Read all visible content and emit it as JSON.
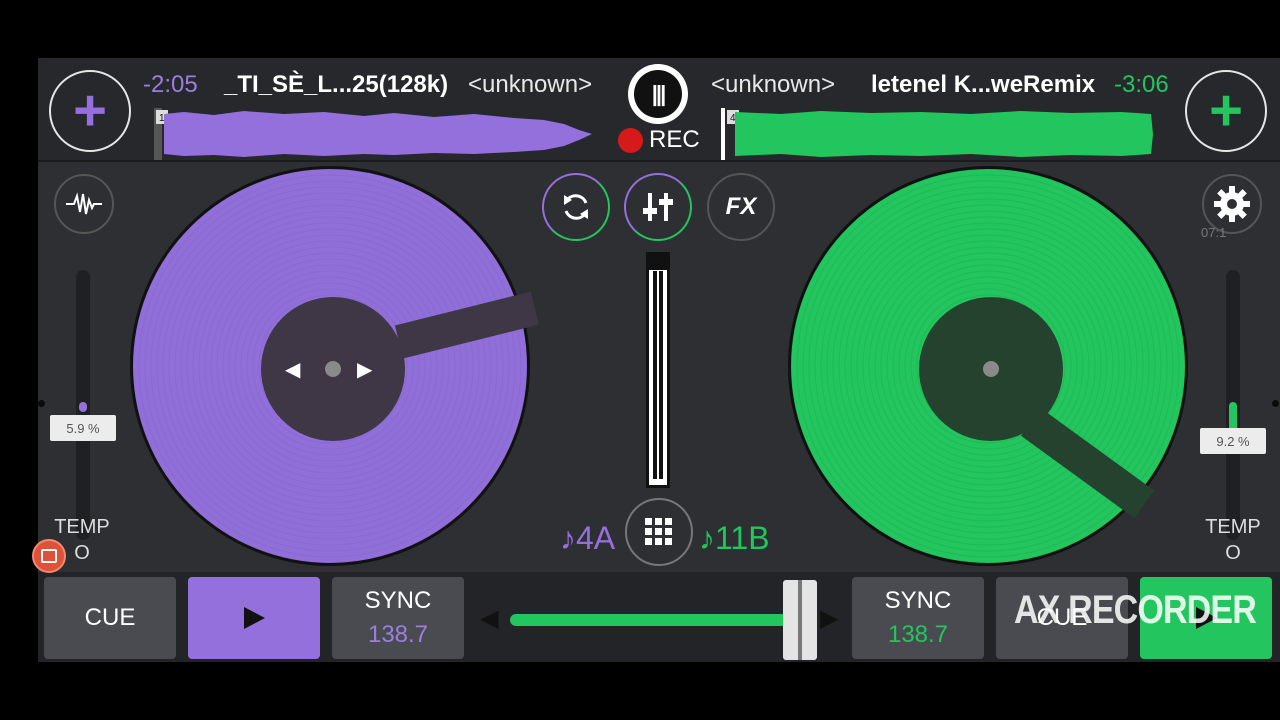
{
  "deck_left": {
    "time_remaining": "-2:05",
    "title": "_TI_SÈ_L...25(128k)",
    "artist": "<unknown>",
    "cue_marker": "1",
    "key": "♪4A",
    "tempo_value": "5.9 %",
    "tempo_label": "TEMP",
    "tempo_sub": "O",
    "cue_label": "CUE",
    "sync_label": "SYNC",
    "bpm": "138.7",
    "accent_color": "#9370db"
  },
  "deck_right": {
    "time_remaining": "-3:06",
    "title": "letenel K...weRemix",
    "artist": "<unknown>",
    "cue_marker": "4",
    "key": "♪11B",
    "tempo_value": "9.2 %",
    "tempo_label": "TEMP",
    "tempo_sub": "O",
    "cue_label": "CUE",
    "sync_label": "SYNC",
    "bpm": "138.7",
    "accent_color": "#22c55e"
  },
  "record": {
    "label": "REC"
  },
  "center": {
    "fx_label": "FX",
    "settings_sub": "07:1"
  },
  "crossfader": {
    "position": 0.95
  },
  "watermark": {
    "text": "AX RECORDER"
  },
  "icons": {
    "add_track": "plus-icon",
    "waveform": "waveform-icon",
    "settings": "gear-icon",
    "loop": "sync-loop-icon",
    "mixer": "mixer-sliders-icon",
    "grid": "grid-icon",
    "play": "play-icon"
  }
}
